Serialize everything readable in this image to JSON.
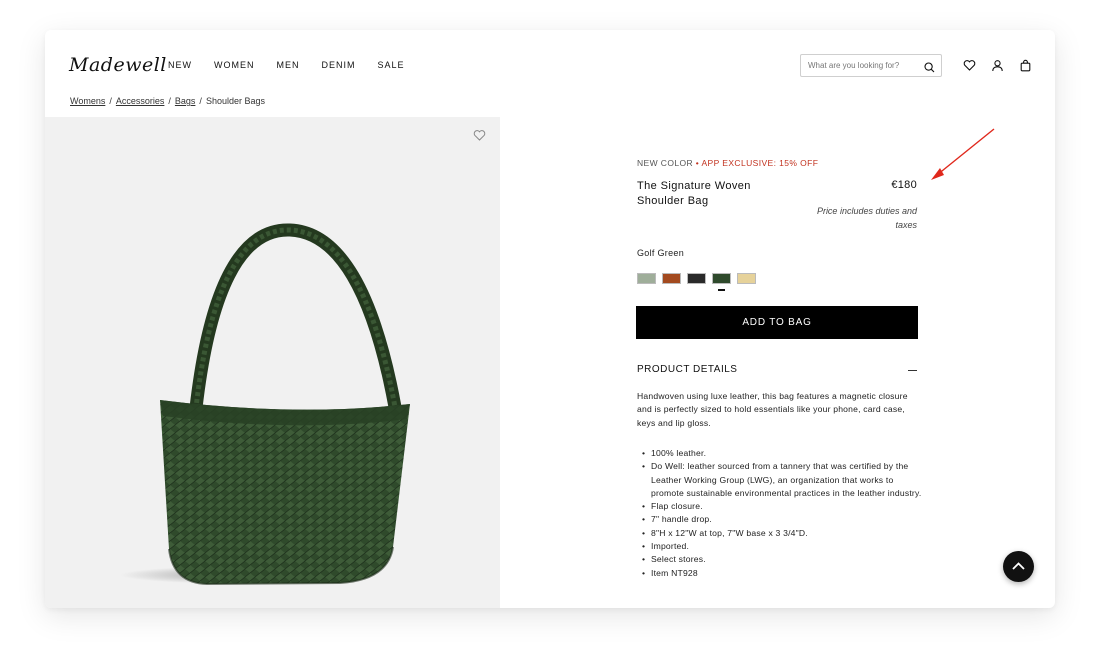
{
  "header": {
    "logo": "Madewell",
    "nav": [
      "NEW",
      "WOMEN",
      "MEN",
      "DENIM",
      "SALE"
    ],
    "search_placeholder": "What are you looking for?",
    "icons": [
      "heart-icon",
      "account-icon",
      "bag-icon"
    ]
  },
  "breadcrumb": {
    "items": [
      "Womens",
      "Accessories",
      "Bags"
    ],
    "current": "Shoulder Bags"
  },
  "product": {
    "promo_new": "NEW COLOR",
    "promo_sep": " • ",
    "promo_exclusive": "APP EXCLUSIVE: 15% OFF",
    "title": "The Signature Woven Shoulder Bag",
    "price": "€180",
    "duties": "Price includes duties and taxes",
    "color_name": "Golf Green",
    "swatches": [
      {
        "name": "sage",
        "color": "#9fae9a"
      },
      {
        "name": "cognac",
        "color": "#a34a1f"
      },
      {
        "name": "black",
        "color": "#2a2a2a"
      },
      {
        "name": "golf-green",
        "color": "#2f4a2c"
      },
      {
        "name": "natural",
        "color": "#e6d29a"
      }
    ],
    "selected_swatch": 3,
    "add_to_bag": "ADD TO BAG",
    "details_heading": "PRODUCT DETAILS",
    "description": "Handwoven using luxe leather, this bag features a magnetic closure and is perfectly sized to hold essentials like your phone, card case, keys and lip gloss.",
    "bullets": [
      "100% leather.",
      "Do Well: leather sourced from a tannery that was certified by the Leather Working Group (LWG), an organization that works to promote sustainable environmental practices in the leather industry.",
      "Flap closure.",
      "7\" handle drop.",
      "8\"H x 12\"W at top, 7\"W base x 3 3/4\"D.",
      "Imported.",
      "Select stores.",
      "Item NT928"
    ]
  },
  "colors": {
    "accent_red": "#c2321f",
    "bag_green": "#2e4a2a",
    "button_black": "#000000"
  }
}
